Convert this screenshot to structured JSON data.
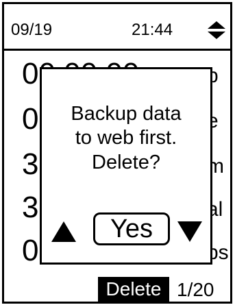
{
  "status_bar": {
    "date": "09/19",
    "time": "21:44",
    "sort_icon": "up-down-triangle-icon"
  },
  "list": {
    "rows": [
      {
        "value": "00:00:00",
        "label": "p"
      },
      {
        "value": "0",
        "label": "e"
      },
      {
        "value": "3",
        "label": "m"
      },
      {
        "value": "3",
        "label": "al"
      },
      {
        "value": "0",
        "label": "ps"
      }
    ]
  },
  "dialog": {
    "message_lines": [
      "Backup data",
      "to web first.",
      "Delete?"
    ],
    "confirm_label": "Yes",
    "prev_icon": "triangle-up-icon",
    "next_icon": "triangle-down-icon"
  },
  "footer": {
    "delete_label": "Delete",
    "page": "1/20"
  }
}
